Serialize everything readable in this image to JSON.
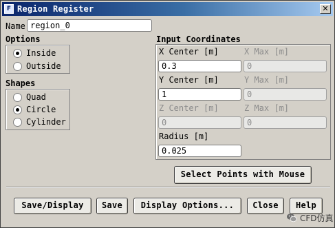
{
  "window": {
    "title": "Region Register",
    "icon_letter": "F",
    "close_symbol": "✕"
  },
  "name": {
    "label": "Name",
    "value": "region_0"
  },
  "options": {
    "heading": "Options",
    "items": [
      {
        "label": "Inside",
        "selected": true
      },
      {
        "label": "Outside",
        "selected": false
      }
    ]
  },
  "shapes": {
    "heading": "Shapes",
    "items": [
      {
        "label": "Quad",
        "selected": false
      },
      {
        "label": "Circle",
        "selected": true
      },
      {
        "label": "Cylinder",
        "selected": false
      }
    ]
  },
  "input_coordinates": {
    "heading": "Input Coordinates",
    "x_center": {
      "label": "X Center [m]",
      "value": "0.3",
      "enabled": true
    },
    "x_max": {
      "label": "X Max [m]",
      "value": "0",
      "enabled": false
    },
    "y_center": {
      "label": "Y Center [m]",
      "value": "1",
      "enabled": true
    },
    "y_max": {
      "label": "Y Max [m]",
      "value": "0",
      "enabled": false
    },
    "z_center": {
      "label": "Z Center [m]",
      "value": "0",
      "enabled": false
    },
    "z_max": {
      "label": "Z Max [m]",
      "value": "0",
      "enabled": false
    },
    "radius": {
      "label": "Radius [m]",
      "value": "0.025",
      "enabled": true
    }
  },
  "select_points_button": "Select Points with Mouse",
  "buttons": {
    "save_display": "Save/Display",
    "save": "Save",
    "display_options": "Display Options...",
    "close": "Close",
    "help": "Help"
  },
  "watermark": {
    "text": "CFD仿真",
    "icon": "wechat-icon"
  }
}
